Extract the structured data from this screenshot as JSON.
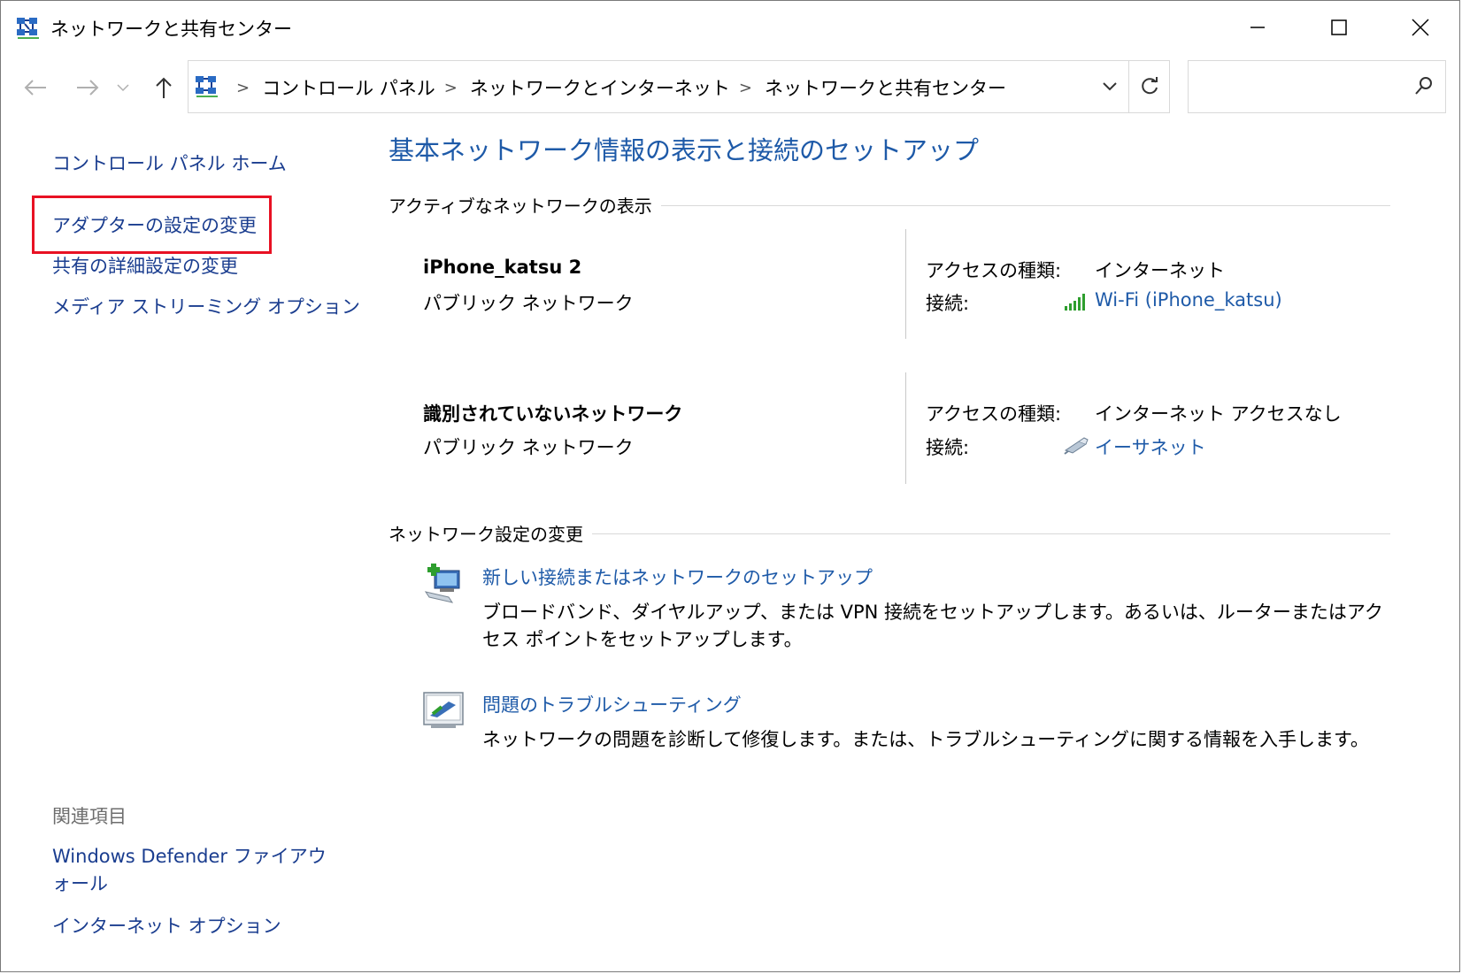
{
  "window": {
    "title": "ネットワークと共有センター"
  },
  "address": {
    "crumbs": [
      "コントロール パネル",
      "ネットワークとインターネット",
      "ネットワークと共有センター"
    ],
    "separator": ">"
  },
  "search": {
    "placeholder": ""
  },
  "sidebar": {
    "links": [
      "コントロール パネル ホーム",
      "アダプターの設定の変更",
      "共有の詳細設定の変更",
      "メディア ストリーミング オプション"
    ],
    "related_heading": "関連項目",
    "related_links": [
      "Windows Defender ファイアウォール",
      "インターネット オプション"
    ]
  },
  "main": {
    "title": "基本ネットワーク情報の表示と接続のセットアップ",
    "active_heading": "アクティブなネットワークの表示",
    "networks": [
      {
        "name": "iPhone_katsu 2",
        "type": "パブリック ネットワーク",
        "access_label": "アクセスの種類:",
        "access_value": "インターネット",
        "connection_label": "接続:",
        "connection_value": "Wi-Fi (iPhone_katsu)",
        "connection_icon": "wifi-signal-icon"
      },
      {
        "name": "識別されていないネットワーク",
        "type": "パブリック ネットワーク",
        "access_label": "アクセスの種類:",
        "access_value": "インターネット アクセスなし",
        "connection_label": "接続:",
        "connection_value": "イーサネット",
        "connection_icon": "ethernet-icon"
      }
    ],
    "settings_heading": "ネットワーク設定の変更",
    "tasks": [
      {
        "link": "新しい接続またはネットワークのセットアップ",
        "desc": "ブロードバンド、ダイヤルアップ、または VPN 接続をセットアップします。あるいは、ルーターまたはアクセス ポイントをセットアップします。",
        "icon": "new-connection-icon"
      },
      {
        "link": "問題のトラブルシューティング",
        "desc": "ネットワークの問題を診断して修復します。または、トラブルシューティングに関する情報を入手します。",
        "icon": "troubleshoot-icon"
      }
    ]
  },
  "colors": {
    "link": "#1e5aa8",
    "sidebar_link": "#1a3d8f",
    "highlight_box": "#e81123",
    "wifi_green": "#2e9e2e"
  }
}
